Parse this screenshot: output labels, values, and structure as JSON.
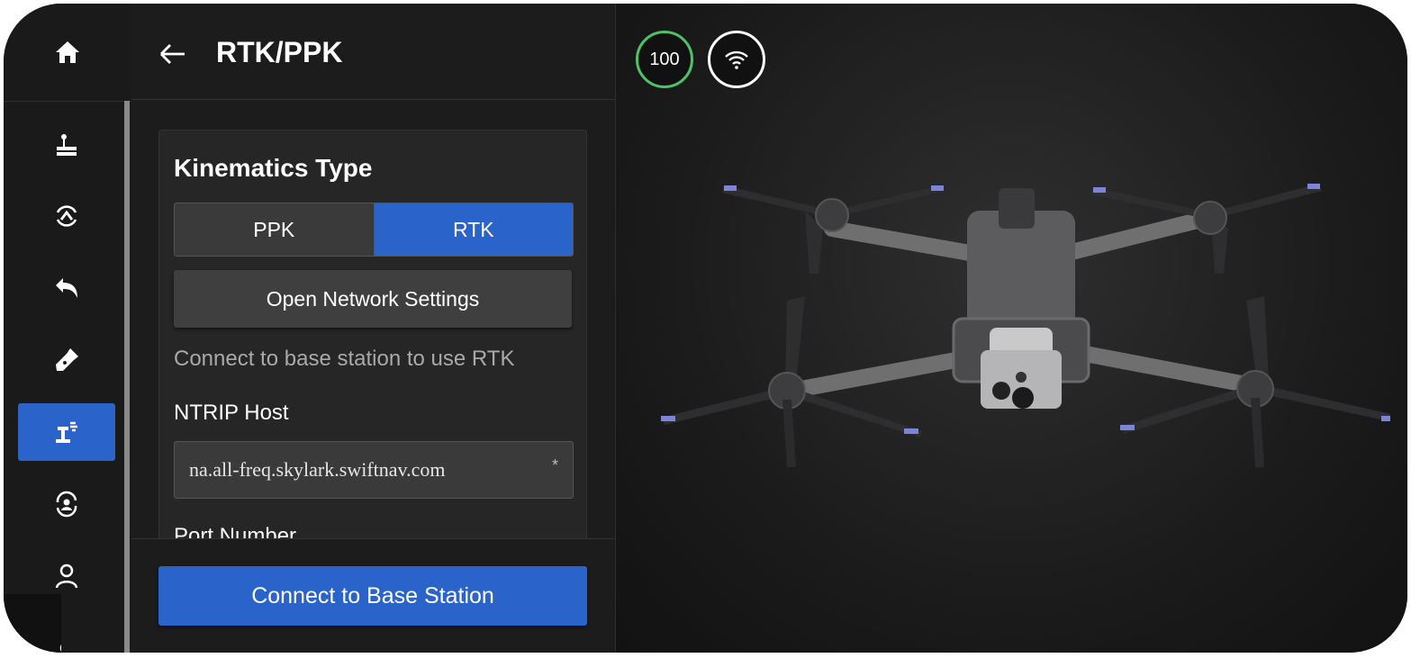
{
  "header": {
    "title": "RTK/PPK"
  },
  "kinematics": {
    "title": "Kinematics Type",
    "options": [
      "PPK",
      "RTK"
    ],
    "selected": "RTK",
    "network_button": "Open Network Settings",
    "hint": "Connect to base station to use RTK"
  },
  "ntrip": {
    "host_label": "NTRIP Host",
    "host_value": "na.all-freq.skylark.swiftnav.com",
    "required_mark": "*",
    "port_label": "Port Number"
  },
  "footer": {
    "connect_button": "Connect to Base Station"
  },
  "status": {
    "battery": "100",
    "battery_color": "#4bc36b"
  },
  "colors": {
    "accent": "#2a63c9",
    "background": "#1c1c1c"
  },
  "rail": {
    "icons": [
      "home-icon",
      "joystick-icon",
      "compass-up-icon",
      "return-icon",
      "flashlight-icon",
      "rtk-antenna-icon",
      "user-sync-icon",
      "user-icon"
    ],
    "active": "rtk-antenna-icon"
  }
}
